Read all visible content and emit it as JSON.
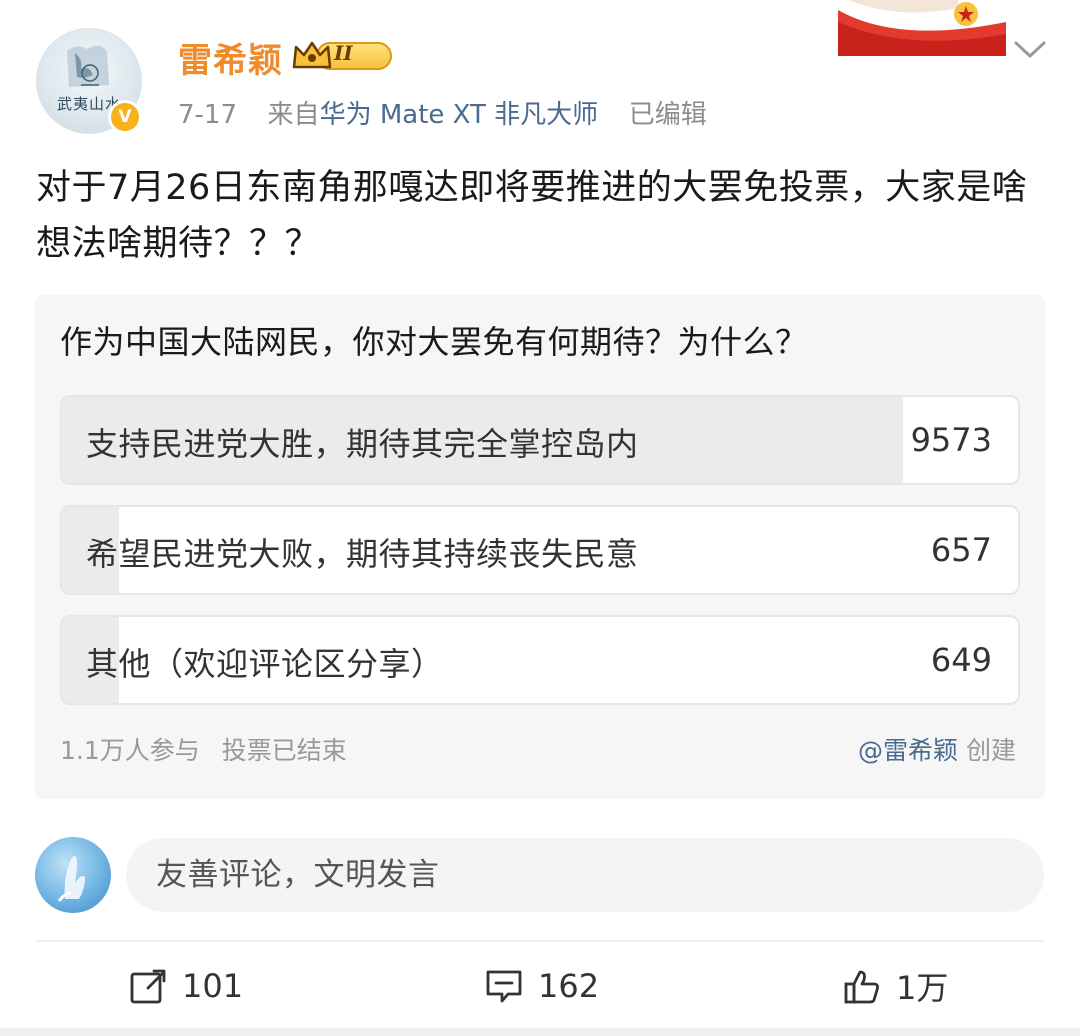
{
  "user": {
    "name": "雷希颖",
    "level_badge": "II",
    "avatar_text": "武夷山水"
  },
  "meta": {
    "date": "7-17",
    "source_prefix": "来自",
    "source_device": "华为 Mate XT 非凡大师",
    "edited": "已编辑"
  },
  "post": {
    "text": "对于7月26日东南角那嘎达即将要推进的大罢免投票，大家是啥想法啥期待？？？"
  },
  "poll": {
    "question": "作为中国大陆网民，你对大罢免有何期待？为什么？",
    "options": [
      {
        "label": "支持民进党大胜，期待其完全掌控岛内",
        "count": "9573",
        "share": 0.88
      },
      {
        "label": "希望民进党大败，期待其持续丧失民意",
        "count": "657",
        "share": 0.06
      },
      {
        "label": "其他（欢迎评论区分享）",
        "count": "649",
        "share": 0.06
      }
    ],
    "participants": "1.1万人参与",
    "status": "投票已结束",
    "creator": "@雷希颖",
    "creator_suffix": "创建"
  },
  "comment": {
    "placeholder": "友善评论，文明发言"
  },
  "actions": {
    "repost_count": "101",
    "comment_count": "162",
    "like_count": "1万"
  },
  "colors": {
    "username": "#f08b2c",
    "link": "#4a6a8f",
    "poll_bg": "#f6f6f6",
    "poll_fill": "#ebebeb"
  },
  "icons": [
    "verified-badge-icon",
    "crown-level-icon",
    "chevron-down-icon",
    "repost-icon",
    "comment-icon",
    "like-icon"
  ]
}
